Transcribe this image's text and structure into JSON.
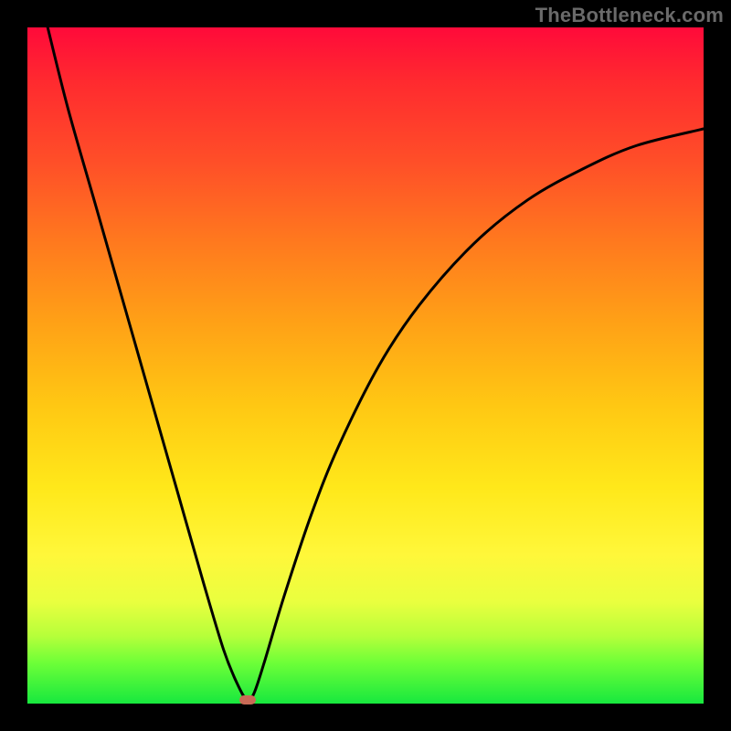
{
  "attribution": "TheBottleneck.com",
  "gradient_colors": {
    "top": "#ff0a3a",
    "mid_upper": "#ff7a1e",
    "mid": "#ffe81a",
    "bottom": "#17e83e"
  },
  "marker_color": "#c96a56",
  "chart_data": {
    "type": "line",
    "title": "",
    "xlabel": "",
    "ylabel": "",
    "xlim": [
      0,
      100
    ],
    "ylim": [
      0,
      100
    ],
    "grid": false,
    "legend": false,
    "series": [
      {
        "name": "bottleneck-curve",
        "x": [
          3,
          6,
          10,
          14,
          18,
          22,
          26,
          29,
          31,
          32.5,
          33.5,
          35,
          38,
          42,
          46,
          52,
          58,
          66,
          74,
          82,
          90,
          100
        ],
        "y": [
          100,
          88,
          74,
          60,
          46,
          32,
          18,
          8,
          3,
          0.5,
          1.5,
          6,
          16,
          28,
          38,
          50,
          59,
          68,
          74.5,
          79,
          82.5,
          85
        ]
      }
    ],
    "minimum_point": {
      "x": 32.5,
      "y": 0.5
    }
  }
}
